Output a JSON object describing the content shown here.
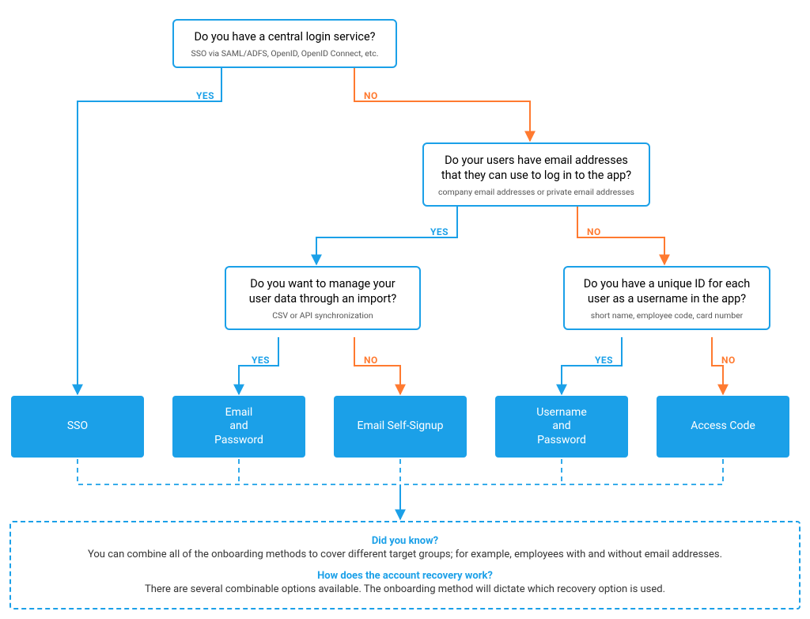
{
  "decisions": {
    "q1": {
      "question": "Do you have a central login service?",
      "sub": "SSO via SAML/ADFS, OpenID, OpenID Connect, etc."
    },
    "q2": {
      "question": "Do your users have email addresses that they can use to log in to the app?",
      "sub": "company email addresses or private email addresses"
    },
    "q3": {
      "question": "Do you want to manage your user data through an import?",
      "sub": "CSV or API synchronization"
    },
    "q4": {
      "question": "Do you have a unique ID for each user as a username in the app?",
      "sub": "short name, employee code, card number"
    }
  },
  "results": {
    "sso": "SSO",
    "email_pw": "Email\nand\nPassword",
    "self_signup": "Email Self-Signup",
    "user_pw": "Username\nand\nPassword",
    "access_code": "Access Code"
  },
  "labels": {
    "yes": "YES",
    "no": "NO"
  },
  "info": {
    "h1": "Did you know?",
    "p1": "You can combine all of the onboarding methods to cover different target groups; for example, employees with and without email addresses.",
    "h2": "How does the account recovery work?",
    "p2": "There are several combinable options available. The onboarding method will dictate which recovery option is used."
  },
  "colors": {
    "blue": "#1ba0e8",
    "orange": "#ff7a30"
  }
}
